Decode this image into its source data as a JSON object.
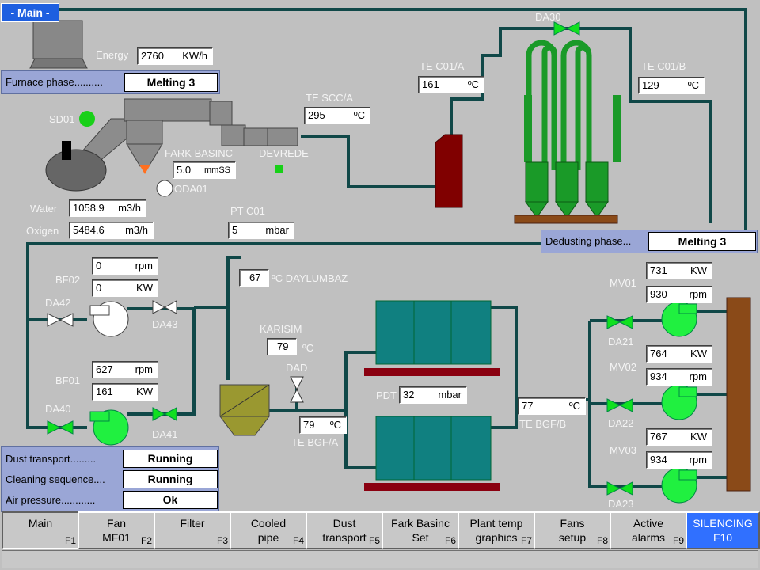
{
  "title_tab": "- Main -",
  "energy": {
    "label": "Energy",
    "value": "2760",
    "unit": "KW/h"
  },
  "furnace_phase": {
    "label": "Furnace phase..........",
    "value": "Melting 3"
  },
  "dedusting_phase": {
    "label": "Dedusting phase...",
    "value": "Melting 3"
  },
  "te_scc_a": {
    "label": "TE SCC/A",
    "value": "295",
    "unit": "ºC"
  },
  "te_c01_a": {
    "label": "TE C01/A",
    "value": "161",
    "unit": "ºC"
  },
  "te_c01_b": {
    "label": "TE C01/B",
    "value": "129",
    "unit": "ºC"
  },
  "da30": "DA30",
  "sd01": "SD01",
  "fark_basinc": {
    "label": "FARK BASINC",
    "value": "5.0",
    "unit": "mmSS"
  },
  "devrede": "DEVREDE",
  "oda01": "ODA01",
  "water": {
    "label": "Water",
    "value": "1058.9",
    "unit": "m3/h"
  },
  "oxigen": {
    "label": "Oxigen",
    "value": "5484.6",
    "unit": "m3/h"
  },
  "pt_c01": {
    "label": "PT C01",
    "value": "5",
    "unit": "mbar"
  },
  "bf02": {
    "label": "BF02",
    "rpm": "0",
    "rpm_unit": "rpm",
    "kw": "0",
    "kw_unit": "KW"
  },
  "bf01": {
    "label": "BF01",
    "rpm": "627",
    "rpm_unit": "rpm",
    "kw": "161",
    "kw_unit": "KW"
  },
  "da42": "DA42",
  "da43": "DA43",
  "da40": "DA40",
  "da41": "DA41",
  "daylumbaz": {
    "value": "67",
    "unit": "ºC DAYLUMBAZ"
  },
  "karisim": {
    "label": "KARISIM",
    "value": "79",
    "unit": "ºC"
  },
  "dad": "DAD",
  "te_bgf_a": {
    "label": "TE BGF/A",
    "value": "79",
    "unit": "ºC"
  },
  "pdt": {
    "label": "PDT",
    "value": "32",
    "unit": "mbar"
  },
  "te_bgf_b": {
    "label": "TE BGF/B",
    "value": "77",
    "unit": "ºC"
  },
  "mv01": {
    "label": "MV01",
    "kw": "731",
    "kw_unit": "KW",
    "rpm": "930",
    "rpm_unit": "rpm"
  },
  "mv02": {
    "label": "MV02",
    "kw": "764",
    "kw_unit": "KW",
    "rpm": "934",
    "rpm_unit": "rpm"
  },
  "mv03": {
    "label": "MV03",
    "kw": "767",
    "kw_unit": "KW",
    "rpm": "934",
    "rpm_unit": "rpm"
  },
  "da21": "DA21",
  "da22": "DA22",
  "da23": "DA23",
  "status": [
    {
      "label": "Dust transport.........",
      "value": "Running"
    },
    {
      "label": "Cleaning sequence....",
      "value": "Running"
    },
    {
      "label": "Air pressure............",
      "value": "Ok"
    }
  ],
  "fkeys": [
    {
      "label": "Main",
      "key": "F1"
    },
    {
      "label": "Fan\nMF01",
      "key": "F2"
    },
    {
      "label": "Filter",
      "key": "F3"
    },
    {
      "label": "Cooled\npipe",
      "key": "F4"
    },
    {
      "label": "Dust\ntransport",
      "key": "F5"
    },
    {
      "label": "Fark Basinc\nSet",
      "key": "F6"
    },
    {
      "label": "Plant temp\ngraphics",
      "key": "F7"
    },
    {
      "label": "Fans\nsetup",
      "key": "F8"
    },
    {
      "label": "Active\nalarms",
      "key": "F9"
    },
    {
      "label": "SILENCING\nF10",
      "key": ""
    }
  ],
  "colors": {
    "pipe": "#104848",
    "valve": "#10e020",
    "fan": "#20f040",
    "filter": "#108080",
    "stack": "#8a4a18",
    "cooler": "#1a9a28",
    "quench": "#800000",
    "phase_bg": "#9aa6d6",
    "active_key": "#3070ff"
  }
}
